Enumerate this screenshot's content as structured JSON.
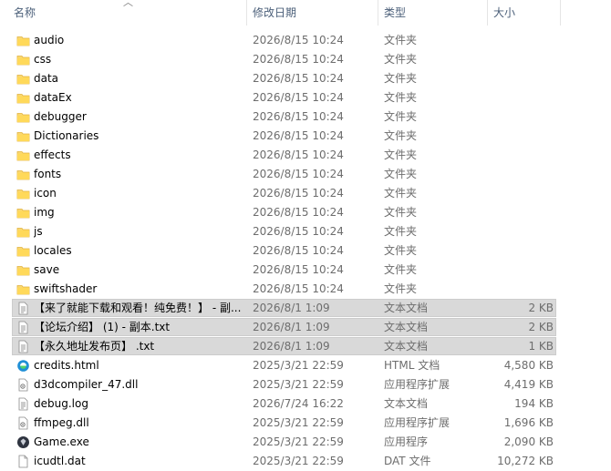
{
  "header": {
    "name": "名称",
    "date": "修改日期",
    "type": "类型",
    "size": "大小"
  },
  "rows": [
    {
      "name": "audio",
      "date": "2026/8/15 10:24",
      "type": "文件夹",
      "size": "",
      "icon": "folder-icon"
    },
    {
      "name": "css",
      "date": "2026/8/15 10:24",
      "type": "文件夹",
      "size": "",
      "icon": "folder-icon"
    },
    {
      "name": "data",
      "date": "2026/8/15 10:24",
      "type": "文件夹",
      "size": "",
      "icon": "folder-icon"
    },
    {
      "name": "dataEx",
      "date": "2026/8/15 10:24",
      "type": "文件夹",
      "size": "",
      "icon": "folder-icon"
    },
    {
      "name": "debugger",
      "date": "2026/8/15 10:24",
      "type": "文件夹",
      "size": "",
      "icon": "folder-icon"
    },
    {
      "name": "Dictionaries",
      "date": "2026/8/15 10:24",
      "type": "文件夹",
      "size": "",
      "icon": "folder-icon"
    },
    {
      "name": "effects",
      "date": "2026/8/15 10:24",
      "type": "文件夹",
      "size": "",
      "icon": "folder-icon"
    },
    {
      "name": "fonts",
      "date": "2026/8/15 10:24",
      "type": "文件夹",
      "size": "",
      "icon": "folder-icon"
    },
    {
      "name": "icon",
      "date": "2026/8/15 10:24",
      "type": "文件夹",
      "size": "",
      "icon": "folder-icon"
    },
    {
      "name": "img",
      "date": "2026/8/15 10:24",
      "type": "文件夹",
      "size": "",
      "icon": "folder-icon"
    },
    {
      "name": "js",
      "date": "2026/8/15 10:24",
      "type": "文件夹",
      "size": "",
      "icon": "folder-icon"
    },
    {
      "name": "locales",
      "date": "2026/8/15 10:24",
      "type": "文件夹",
      "size": "",
      "icon": "folder-icon"
    },
    {
      "name": "save",
      "date": "2026/8/15 10:24",
      "type": "文件夹",
      "size": "",
      "icon": "folder-icon"
    },
    {
      "name": "swiftshader",
      "date": "2026/8/15 10:24",
      "type": "文件夹",
      "size": "",
      "icon": "folder-icon"
    },
    {
      "name": "【来了就能下载和观看！纯免费！】 - 副...",
      "date": "2026/8/1 1:09",
      "type": "文本文档",
      "size": "2 KB",
      "icon": "text-file-icon",
      "selected": true
    },
    {
      "name": "【论坛介绍】 (1) - 副本.txt",
      "date": "2026/8/1 1:09",
      "type": "文本文档",
      "size": "2 KB",
      "icon": "text-file-icon",
      "selected": true
    },
    {
      "name": "【永久地址发布页】 .txt",
      "date": "2026/8/1 1:09",
      "type": "文本文档",
      "size": "1 KB",
      "icon": "text-file-icon",
      "selected": true
    },
    {
      "name": "credits.html",
      "date": "2025/3/21 22:59",
      "type": "HTML 文档",
      "size": "4,580 KB",
      "icon": "edge-html-icon"
    },
    {
      "name": "d3dcompiler_47.dll",
      "date": "2025/3/21 22:59",
      "type": "应用程序扩展",
      "size": "4,419 KB",
      "icon": "dll-file-icon"
    },
    {
      "name": "debug.log",
      "date": "2026/7/24 16:22",
      "type": "文本文档",
      "size": "194 KB",
      "icon": "text-file-icon"
    },
    {
      "name": "ffmpeg.dll",
      "date": "2025/3/21 22:59",
      "type": "应用程序扩展",
      "size": "1,696 KB",
      "icon": "dll-file-icon"
    },
    {
      "name": "Game.exe",
      "date": "2025/3/21 22:59",
      "type": "应用程序",
      "size": "2,090 KB",
      "icon": "app-exe-icon"
    },
    {
      "name": "icudtl.dat",
      "date": "2025/3/21 22:59",
      "type": "DAT 文件",
      "size": "10,272 KB",
      "icon": "blank-file-icon"
    }
  ]
}
